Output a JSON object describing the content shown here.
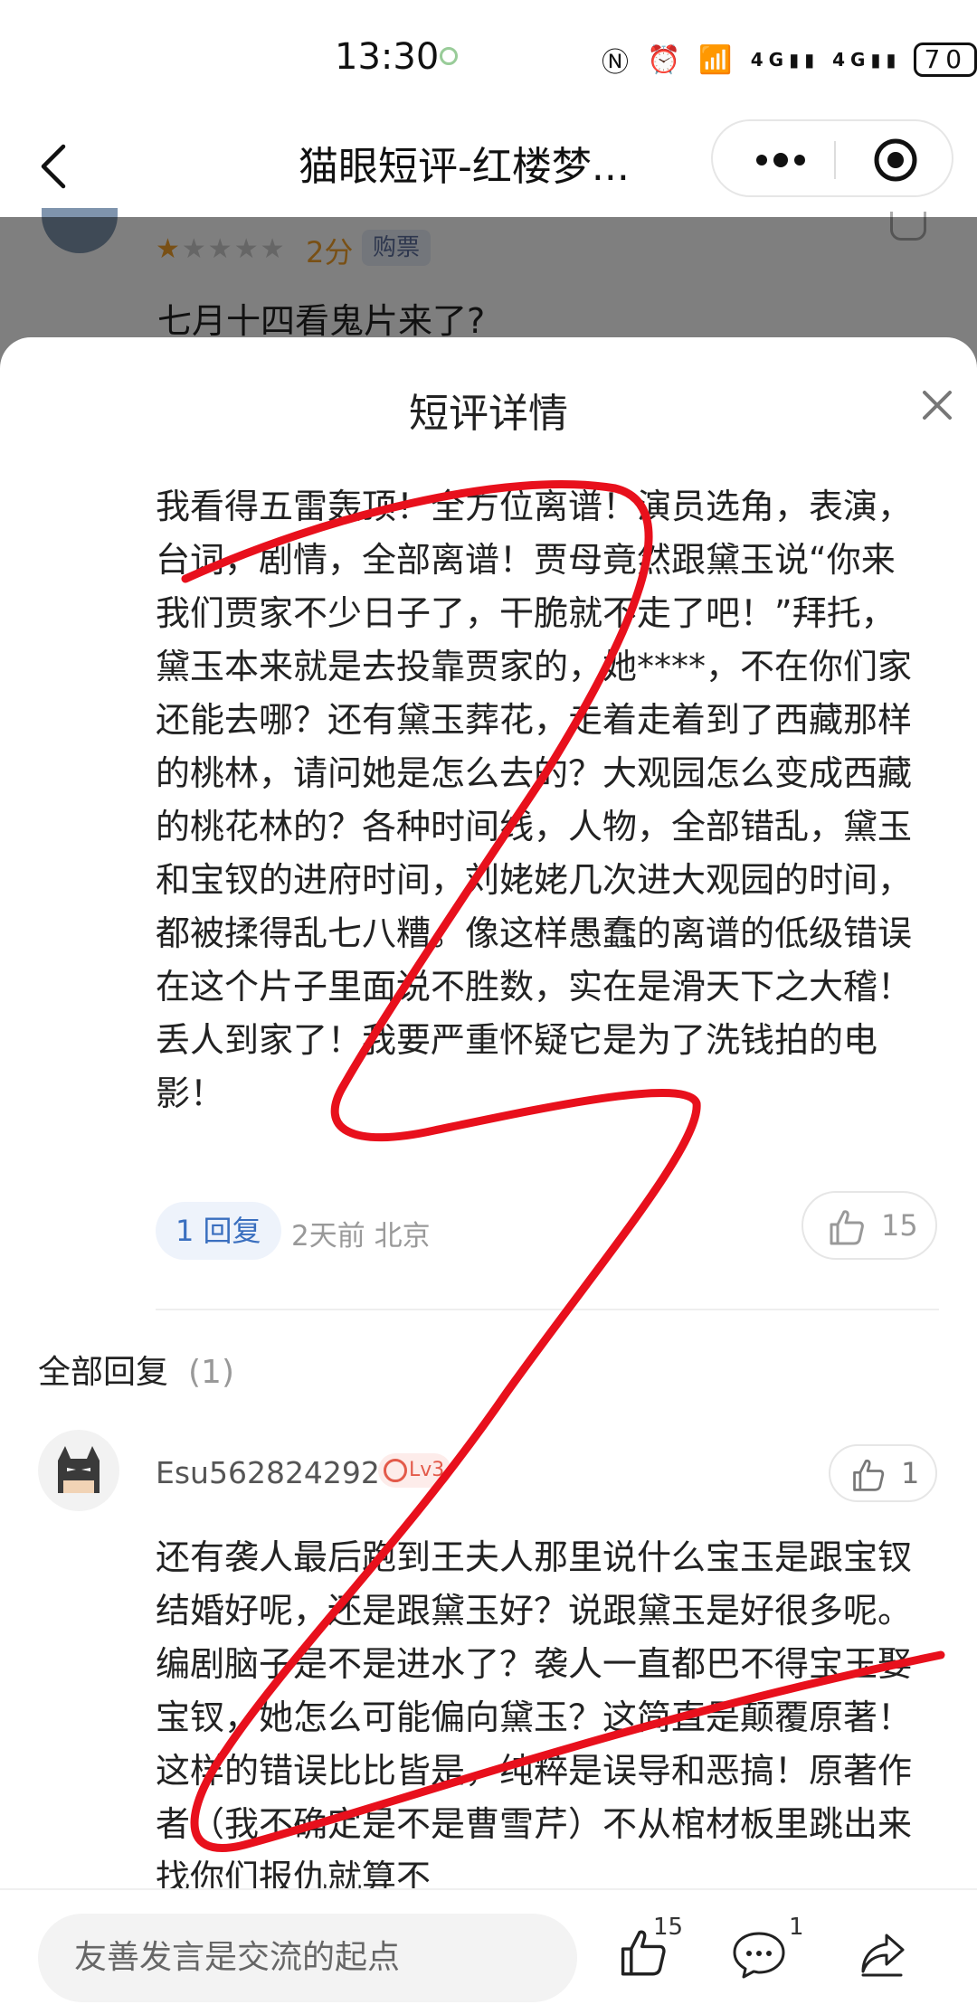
{
  "status_bar": {
    "time": "13:30",
    "network": "4G",
    "battery": "70"
  },
  "title_bar": {
    "title": "猫眼短评-红楼梦..."
  },
  "background_review": {
    "score": "2分",
    "badge": "购票",
    "text": "七月十四看鬼片来了?"
  },
  "sheet": {
    "title": "短评详情",
    "review_text": "我看得五雷轰顶！全方位离谱！演员选角，表演，台词，剧情，全部离谱！贾母竟然跟黛玉说“你来我们贾家不少日子了，干脆就不走了吧！”拜托，黛玉本来就是去投靠贾家的，她****，不在你们家还能去哪？还有黛玉葬花，走着走着到了西藏那样的桃林，请问她是怎么去的？大观园怎么变成西藏的桃花林的？各种时间线，人物，全部错乱，黛玉和宝钗的进府时间，刘姥姥几次进大观园的时间，都被揉得乱七八糟。像这样愚蠢的离谱的低级错误在这个片子里面说不胜数，实在是滑天下之大稽！丢人到家了！我要严重怀疑它是为了洗钱拍的电影！",
    "reply_chip": "1 回复",
    "time_location": "2天前 北京",
    "like_count": "15",
    "all_replies_label": "全部回复",
    "all_replies_count": "(1)"
  },
  "reply": {
    "username": "Esu562824292",
    "level": "Lv3",
    "like_count": "1",
    "text": "还有袭人最后跑到王夫人那里说什么宝玉是跟宝钗结婚好呢，还是跟黛玉好？说跟黛玉是好很多呢。编剧脑子是不是进水了？袭人一直都巴不得宝玉娶宝钗，她怎么可能偏向黛玉？这简直是颠覆原著！这样的错误比比皆是，纯粹是误导和恶搞！原著作者（我不确定是不是曹雪芹）不从棺材板里跳出来找你们报仇就算不"
  },
  "bottom_bar": {
    "input_placeholder": "友善发言是交流的起点",
    "like_count": "15",
    "comment_count": "1"
  },
  "colors": {
    "accent_blue": "#3a6fbf",
    "star": "#f2a02a",
    "scribble_red": "#e8101c"
  }
}
